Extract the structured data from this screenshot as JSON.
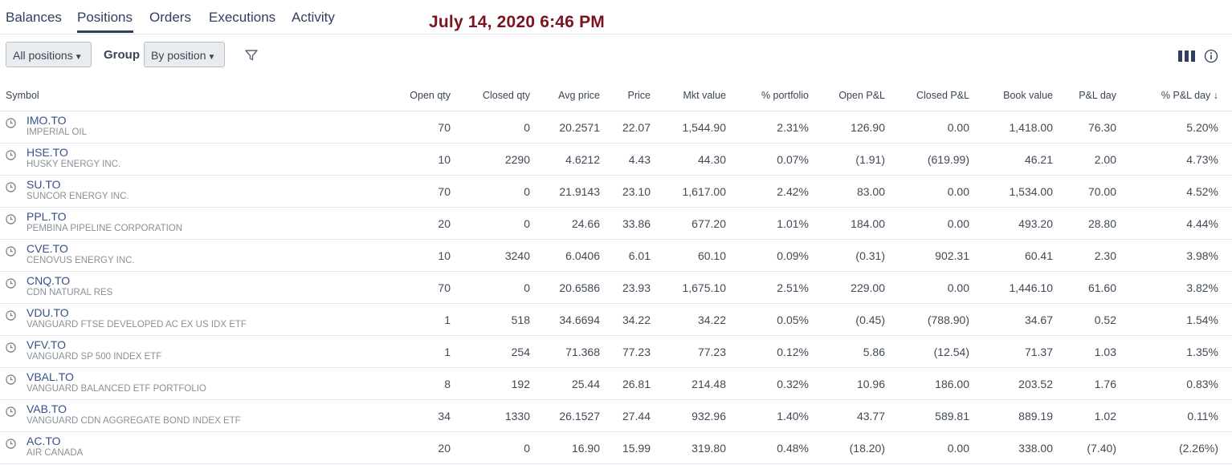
{
  "tabs": [
    "Balances",
    "Positions",
    "Orders",
    "Executions",
    "Activity"
  ],
  "datestamp": "July 14, 2020 6:46 PM",
  "toolbar": {
    "filter_select": "All positions",
    "group_label": "Group",
    "group_select": "By position"
  },
  "columns": [
    "Symbol",
    "Open qty",
    "Closed qty",
    "Avg price",
    "Price",
    "Mkt value",
    "% portfolio",
    "Open P&L",
    "Closed P&L",
    "Book value",
    "P&L day",
    "% P&L day ↓"
  ],
  "rows": [
    {
      "symbol": "IMO.TO",
      "name": "IMPERIAL OIL",
      "open_qty": "70",
      "closed_qty": "0",
      "avg_price": "20.2571",
      "price": "22.07",
      "mkt_value": "1,544.90",
      "pct_portfolio": "2.31%",
      "open_pl": "126.90",
      "closed_pl": "0.00",
      "book_value": "1,418.00",
      "pl_day": "76.30",
      "pct_pl_day": "5.20%"
    },
    {
      "symbol": "HSE.TO",
      "name": "HUSKY ENERGY INC.",
      "open_qty": "10",
      "closed_qty": "2290",
      "avg_price": "4.6212",
      "price": "4.43",
      "mkt_value": "44.30",
      "pct_portfolio": "0.07%",
      "open_pl": "(1.91)",
      "closed_pl": "(619.99)",
      "book_value": "46.21",
      "pl_day": "2.00",
      "pct_pl_day": "4.73%"
    },
    {
      "symbol": "SU.TO",
      "name": "SUNCOR ENERGY INC.",
      "open_qty": "70",
      "closed_qty": "0",
      "avg_price": "21.9143",
      "price": "23.10",
      "mkt_value": "1,617.00",
      "pct_portfolio": "2.42%",
      "open_pl": "83.00",
      "closed_pl": "0.00",
      "book_value": "1,534.00",
      "pl_day": "70.00",
      "pct_pl_day": "4.52%"
    },
    {
      "symbol": "PPL.TO",
      "name": "PEMBINA PIPELINE CORPORATION",
      "open_qty": "20",
      "closed_qty": "0",
      "avg_price": "24.66",
      "price": "33.86",
      "mkt_value": "677.20",
      "pct_portfolio": "1.01%",
      "open_pl": "184.00",
      "closed_pl": "0.00",
      "book_value": "493.20",
      "pl_day": "28.80",
      "pct_pl_day": "4.44%"
    },
    {
      "symbol": "CVE.TO",
      "name": "CENOVUS ENERGY INC.",
      "open_qty": "10",
      "closed_qty": "3240",
      "avg_price": "6.0406",
      "price": "6.01",
      "mkt_value": "60.10",
      "pct_portfolio": "0.09%",
      "open_pl": "(0.31)",
      "closed_pl": "902.31",
      "book_value": "60.41",
      "pl_day": "2.30",
      "pct_pl_day": "3.98%"
    },
    {
      "symbol": "CNQ.TO",
      "name": "CDN NATURAL RES",
      "open_qty": "70",
      "closed_qty": "0",
      "avg_price": "20.6586",
      "price": "23.93",
      "mkt_value": "1,675.10",
      "pct_portfolio": "2.51%",
      "open_pl": "229.00",
      "closed_pl": "0.00",
      "book_value": "1,446.10",
      "pl_day": "61.60",
      "pct_pl_day": "3.82%"
    },
    {
      "symbol": "VDU.TO",
      "name": "VANGUARD FTSE DEVELOPED AC EX US IDX ETF",
      "open_qty": "1",
      "closed_qty": "518",
      "avg_price": "34.6694",
      "price": "34.22",
      "mkt_value": "34.22",
      "pct_portfolio": "0.05%",
      "open_pl": "(0.45)",
      "closed_pl": "(788.90)",
      "book_value": "34.67",
      "pl_day": "0.52",
      "pct_pl_day": "1.54%"
    },
    {
      "symbol": "VFV.TO",
      "name": "VANGUARD SP 500 INDEX ETF",
      "open_qty": "1",
      "closed_qty": "254",
      "avg_price": "71.368",
      "price": "77.23",
      "mkt_value": "77.23",
      "pct_portfolio": "0.12%",
      "open_pl": "5.86",
      "closed_pl": "(12.54)",
      "book_value": "71.37",
      "pl_day": "1.03",
      "pct_pl_day": "1.35%"
    },
    {
      "symbol": "VBAL.TO",
      "name": "VANGUARD BALANCED ETF PORTFOLIO",
      "open_qty": "8",
      "closed_qty": "192",
      "avg_price": "25.44",
      "price": "26.81",
      "mkt_value": "214.48",
      "pct_portfolio": "0.32%",
      "open_pl": "10.96",
      "closed_pl": "186.00",
      "book_value": "203.52",
      "pl_day": "1.76",
      "pct_pl_day": "0.83%"
    },
    {
      "symbol": "VAB.TO",
      "name": "VANGUARD CDN AGGREGATE BOND INDEX ETF",
      "open_qty": "34",
      "closed_qty": "1330",
      "avg_price": "26.1527",
      "price": "27.44",
      "mkt_value": "932.96",
      "pct_portfolio": "1.40%",
      "open_pl": "43.77",
      "closed_pl": "589.81",
      "book_value": "889.19",
      "pl_day": "1.02",
      "pct_pl_day": "0.11%"
    },
    {
      "symbol": "AC.TO",
      "name": "AIR CANADA",
      "open_qty": "20",
      "closed_qty": "0",
      "avg_price": "16.90",
      "price": "15.99",
      "mkt_value": "319.80",
      "pct_portfolio": "0.48%",
      "open_pl": "(18.20)",
      "closed_pl": "0.00",
      "book_value": "338.00",
      "pl_day": "(7.40)",
      "pct_pl_day": "(2.26%)"
    }
  ],
  "colors": {
    "positive": "#2e7d3c",
    "negative": "#b3333a",
    "datestamp": "#7a1520",
    "accent": "#2f3f5c"
  },
  "icons": [
    "clock-icon",
    "filter-icon",
    "columns-icon",
    "info-icon"
  ]
}
